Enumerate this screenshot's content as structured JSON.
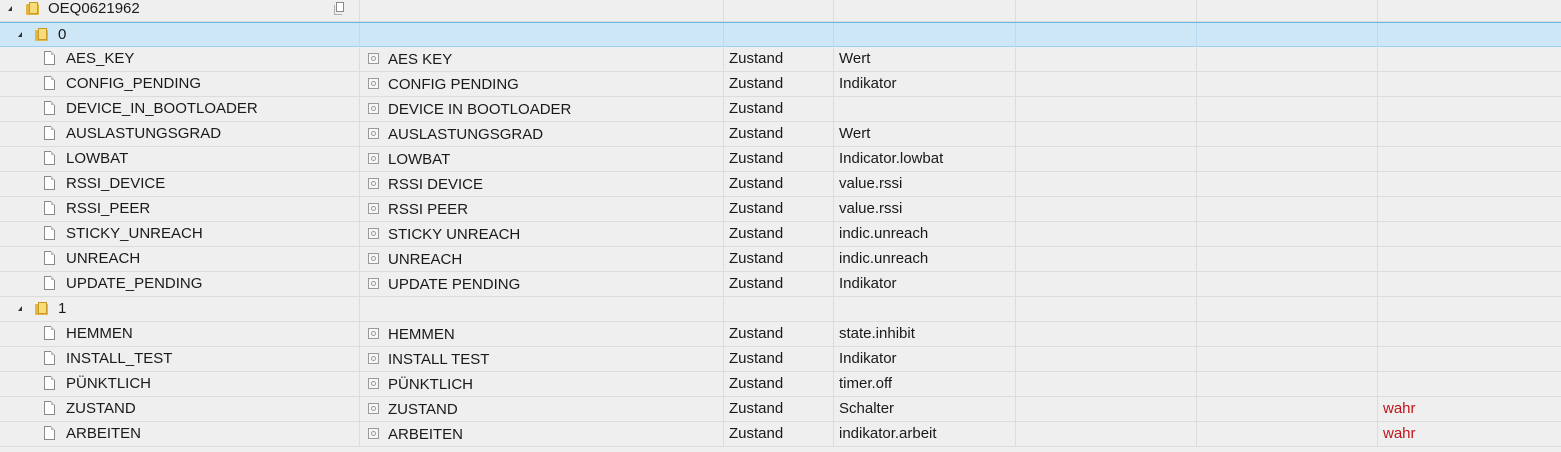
{
  "root": {
    "label": "OEQ0621962"
  },
  "groups": [
    {
      "label": "0",
      "rows": [
        {
          "name": "AES_KEY",
          "display": "AES KEY",
          "type": "Zustand",
          "role": "Wert",
          "value": ""
        },
        {
          "name": "CONFIG_PENDING",
          "display": "CONFIG PENDING",
          "type": "Zustand",
          "role": "Indikator",
          "value": ""
        },
        {
          "name": "DEVICE_IN_BOOTLOADER",
          "display": "DEVICE IN BOOTLOADER",
          "type": "Zustand",
          "role": "",
          "value": ""
        },
        {
          "name": "AUSLASTUNGSGRAD",
          "display": "AUSLASTUNGSGRAD",
          "type": "Zustand",
          "role": "Wert",
          "value": ""
        },
        {
          "name": "LOWBAT",
          "display": "LOWBAT",
          "type": "Zustand",
          "role": "Indicator.lowbat",
          "value": ""
        },
        {
          "name": "RSSI_DEVICE",
          "display": "RSSI DEVICE",
          "type": "Zustand",
          "role": "value.rssi",
          "value": ""
        },
        {
          "name": "RSSI_PEER",
          "display": "RSSI PEER",
          "type": "Zustand",
          "role": "value.rssi",
          "value": ""
        },
        {
          "name": "STICKY_UNREACH",
          "display": "STICKY UNREACH",
          "type": "Zustand",
          "role": "indic.unreach",
          "value": ""
        },
        {
          "name": "UNREACH",
          "display": "UNREACH",
          "type": "Zustand",
          "role": "indic.unreach",
          "value": ""
        },
        {
          "name": "UPDATE_PENDING",
          "display": "UPDATE PENDING",
          "type": "Zustand",
          "role": "Indikator",
          "value": ""
        }
      ]
    },
    {
      "label": "1",
      "rows": [
        {
          "name": "HEMMEN",
          "display": "HEMMEN",
          "type": "Zustand",
          "role": "state.inhibit",
          "value": ""
        },
        {
          "name": "INSTALL_TEST",
          "display": "INSTALL TEST",
          "type": "Zustand",
          "role": "Indikator",
          "value": ""
        },
        {
          "name": "PÜNKTLICH",
          "display": "PÜNKTLICH",
          "type": "Zustand",
          "role": "timer.off",
          "value": ""
        },
        {
          "name": "ZUSTAND",
          "display": "ZUSTAND",
          "type": "Zustand",
          "role": "Schalter",
          "value": "wahr"
        },
        {
          "name": "ARBEITEN",
          "display": "ARBEITEN",
          "type": "Zustand",
          "role": "indikator.arbeit",
          "value": "wahr"
        }
      ]
    }
  ],
  "colors": {
    "selected_bg": "#cde7f7",
    "value_true": "#c0141b",
    "folder": "#e4b63f"
  },
  "icons": {
    "folder": "folder-icon",
    "file": "file-icon",
    "state": "state-icon",
    "copy": "copy-icon",
    "expand": "expand-arrow-icon"
  }
}
